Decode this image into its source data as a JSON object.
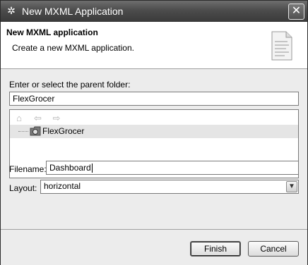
{
  "window": {
    "title": "New MXML Application",
    "app_icon": "flex-builder-icon",
    "close_icon": "close-icon"
  },
  "header": {
    "title": "New MXML application",
    "description": "Create a new MXML application.",
    "icon": "document-icon"
  },
  "form": {
    "parent_folder_label": "Enter or select the parent folder:",
    "parent_folder_value": "FlexGrocer",
    "tree": {
      "toolbar_icons": [
        "home-icon",
        "back-arrow-icon",
        "forward-arrow-icon"
      ],
      "items": [
        {
          "label": "FlexGrocer",
          "icon": "project-folder-icon"
        }
      ]
    },
    "filename_label": "Filename:",
    "filename_value": "Dashboard",
    "layout_label": "Layout:",
    "layout_value": "horizontal"
  },
  "buttons": {
    "finish": "Finish",
    "cancel": "Cancel"
  }
}
